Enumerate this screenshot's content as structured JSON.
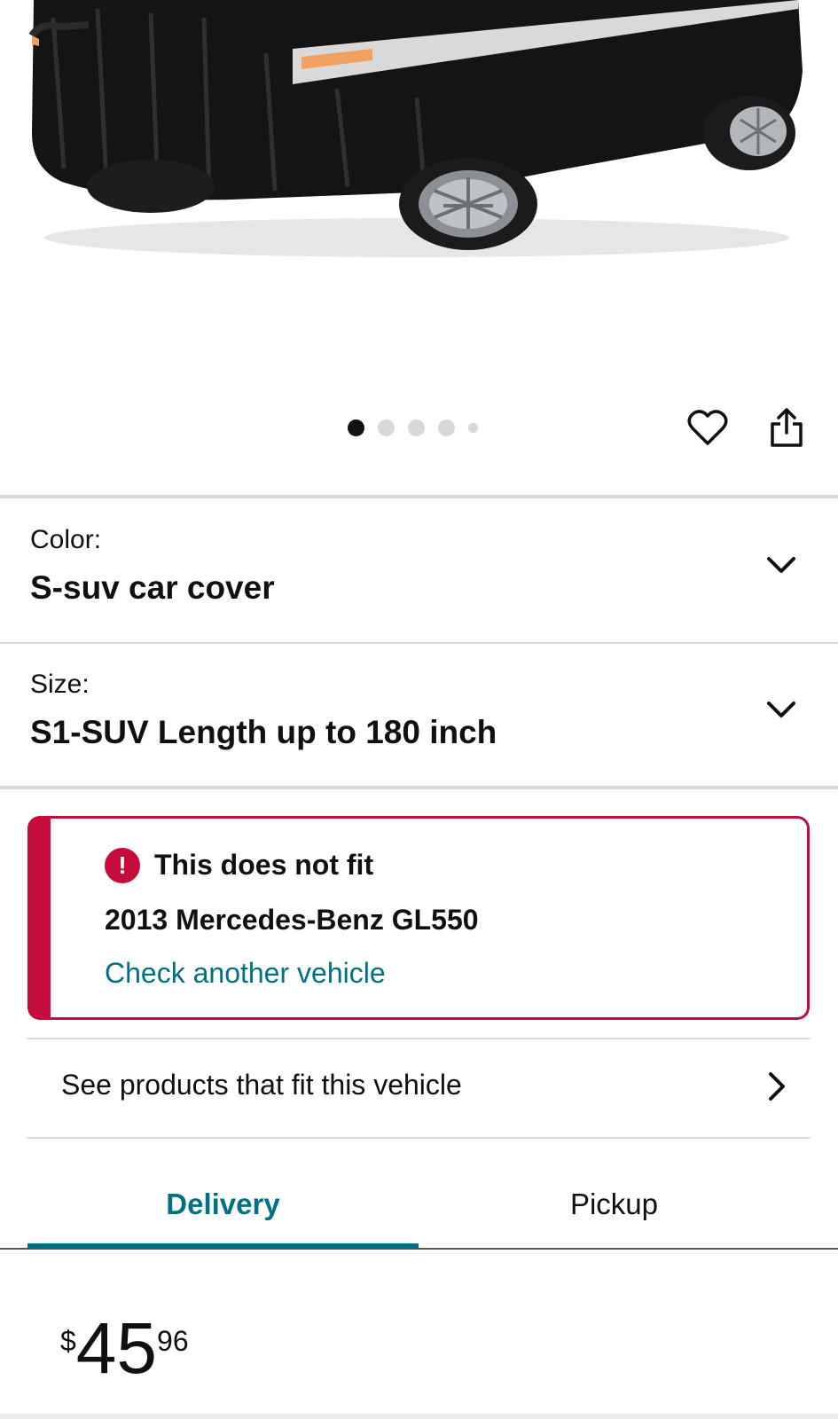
{
  "gallery": {
    "image_alt": "black SUV car cover with reflective stripe",
    "page_count": 5,
    "active_index": 0
  },
  "actions": {
    "wishlist_icon": "heart-icon",
    "share_icon": "share-icon"
  },
  "variations": [
    {
      "label": "Color:",
      "value": "S-suv car cover"
    },
    {
      "label": "Size:",
      "value": "S1-SUV Length up to 180 inch"
    }
  ],
  "fitment": {
    "status": "This does not fit",
    "vehicle": "2013 Mercedes-Benz GL550",
    "check_link": "Check another vehicle",
    "alert_color": "#c40b3b"
  },
  "see_products": "See products that fit this vehicle",
  "tabs": [
    {
      "label": "Delivery",
      "active": true
    },
    {
      "label": "Pickup",
      "active": false
    }
  ],
  "price": {
    "symbol": "$",
    "whole": "45",
    "fraction": "96"
  },
  "colors": {
    "link": "#007185",
    "text": "#0f1111",
    "divider": "#d5d9d9"
  }
}
